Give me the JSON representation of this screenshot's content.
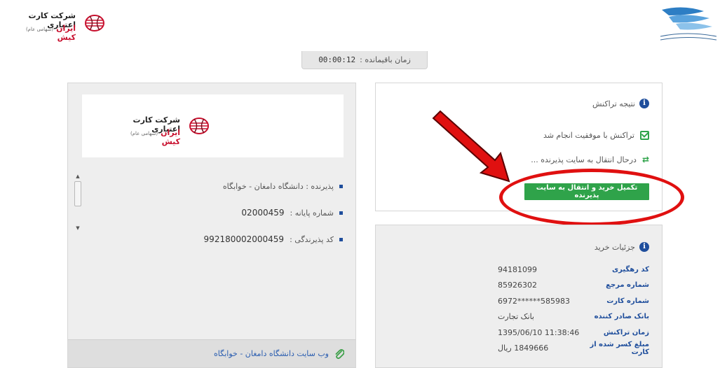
{
  "header": {
    "brand_name": "شرکت کارت اعتباری",
    "brand_sub": "ایران کیش",
    "brand_sub_small": "(سهامی عام)"
  },
  "timer": {
    "label": "زمان باقیمانده :",
    "value": "00:00:12"
  },
  "merchant": {
    "items": [
      {
        "label": "پذیرنده : دانشگاه دامغان - خوابگاه",
        "value": ""
      },
      {
        "label": "شماره پایانه :",
        "value": "02000459"
      },
      {
        "label": "کد پذیرندگی :",
        "value": "992180002000459"
      }
    ],
    "website_link": "وب سایت دانشگاه دامغان - خوابگاه"
  },
  "result": {
    "title": "نتیجه تراکنش",
    "success_text": "تراکنش با موفقیت انجام شد",
    "redirect_text": "درحال انتقال به سایت پذیرنده ...",
    "complete_button": "تکمیل خرید و انتقال به سایت پذیرنده"
  },
  "details": {
    "title": "جزئیات خرید",
    "rows": [
      {
        "label": "کد رهگیری",
        "value": "94181099"
      },
      {
        "label": "شماره مرجع",
        "value": "85926302"
      },
      {
        "label": "شماره کارت",
        "value": "585983******6972"
      },
      {
        "label": "بانک صادر کننده",
        "value": "بانک تجارت"
      },
      {
        "label": "زمان تراکنش",
        "value": "11:38:46 1395/06/10"
      },
      {
        "label": "مبلغ کسر شده از کارت",
        "value": "1849666  ریال"
      }
    ]
  },
  "colors": {
    "accent_blue": "#1f4e9c",
    "success_green": "#2fa34a",
    "annotation_red": "#e01010",
    "brand_red": "#c8102e"
  }
}
